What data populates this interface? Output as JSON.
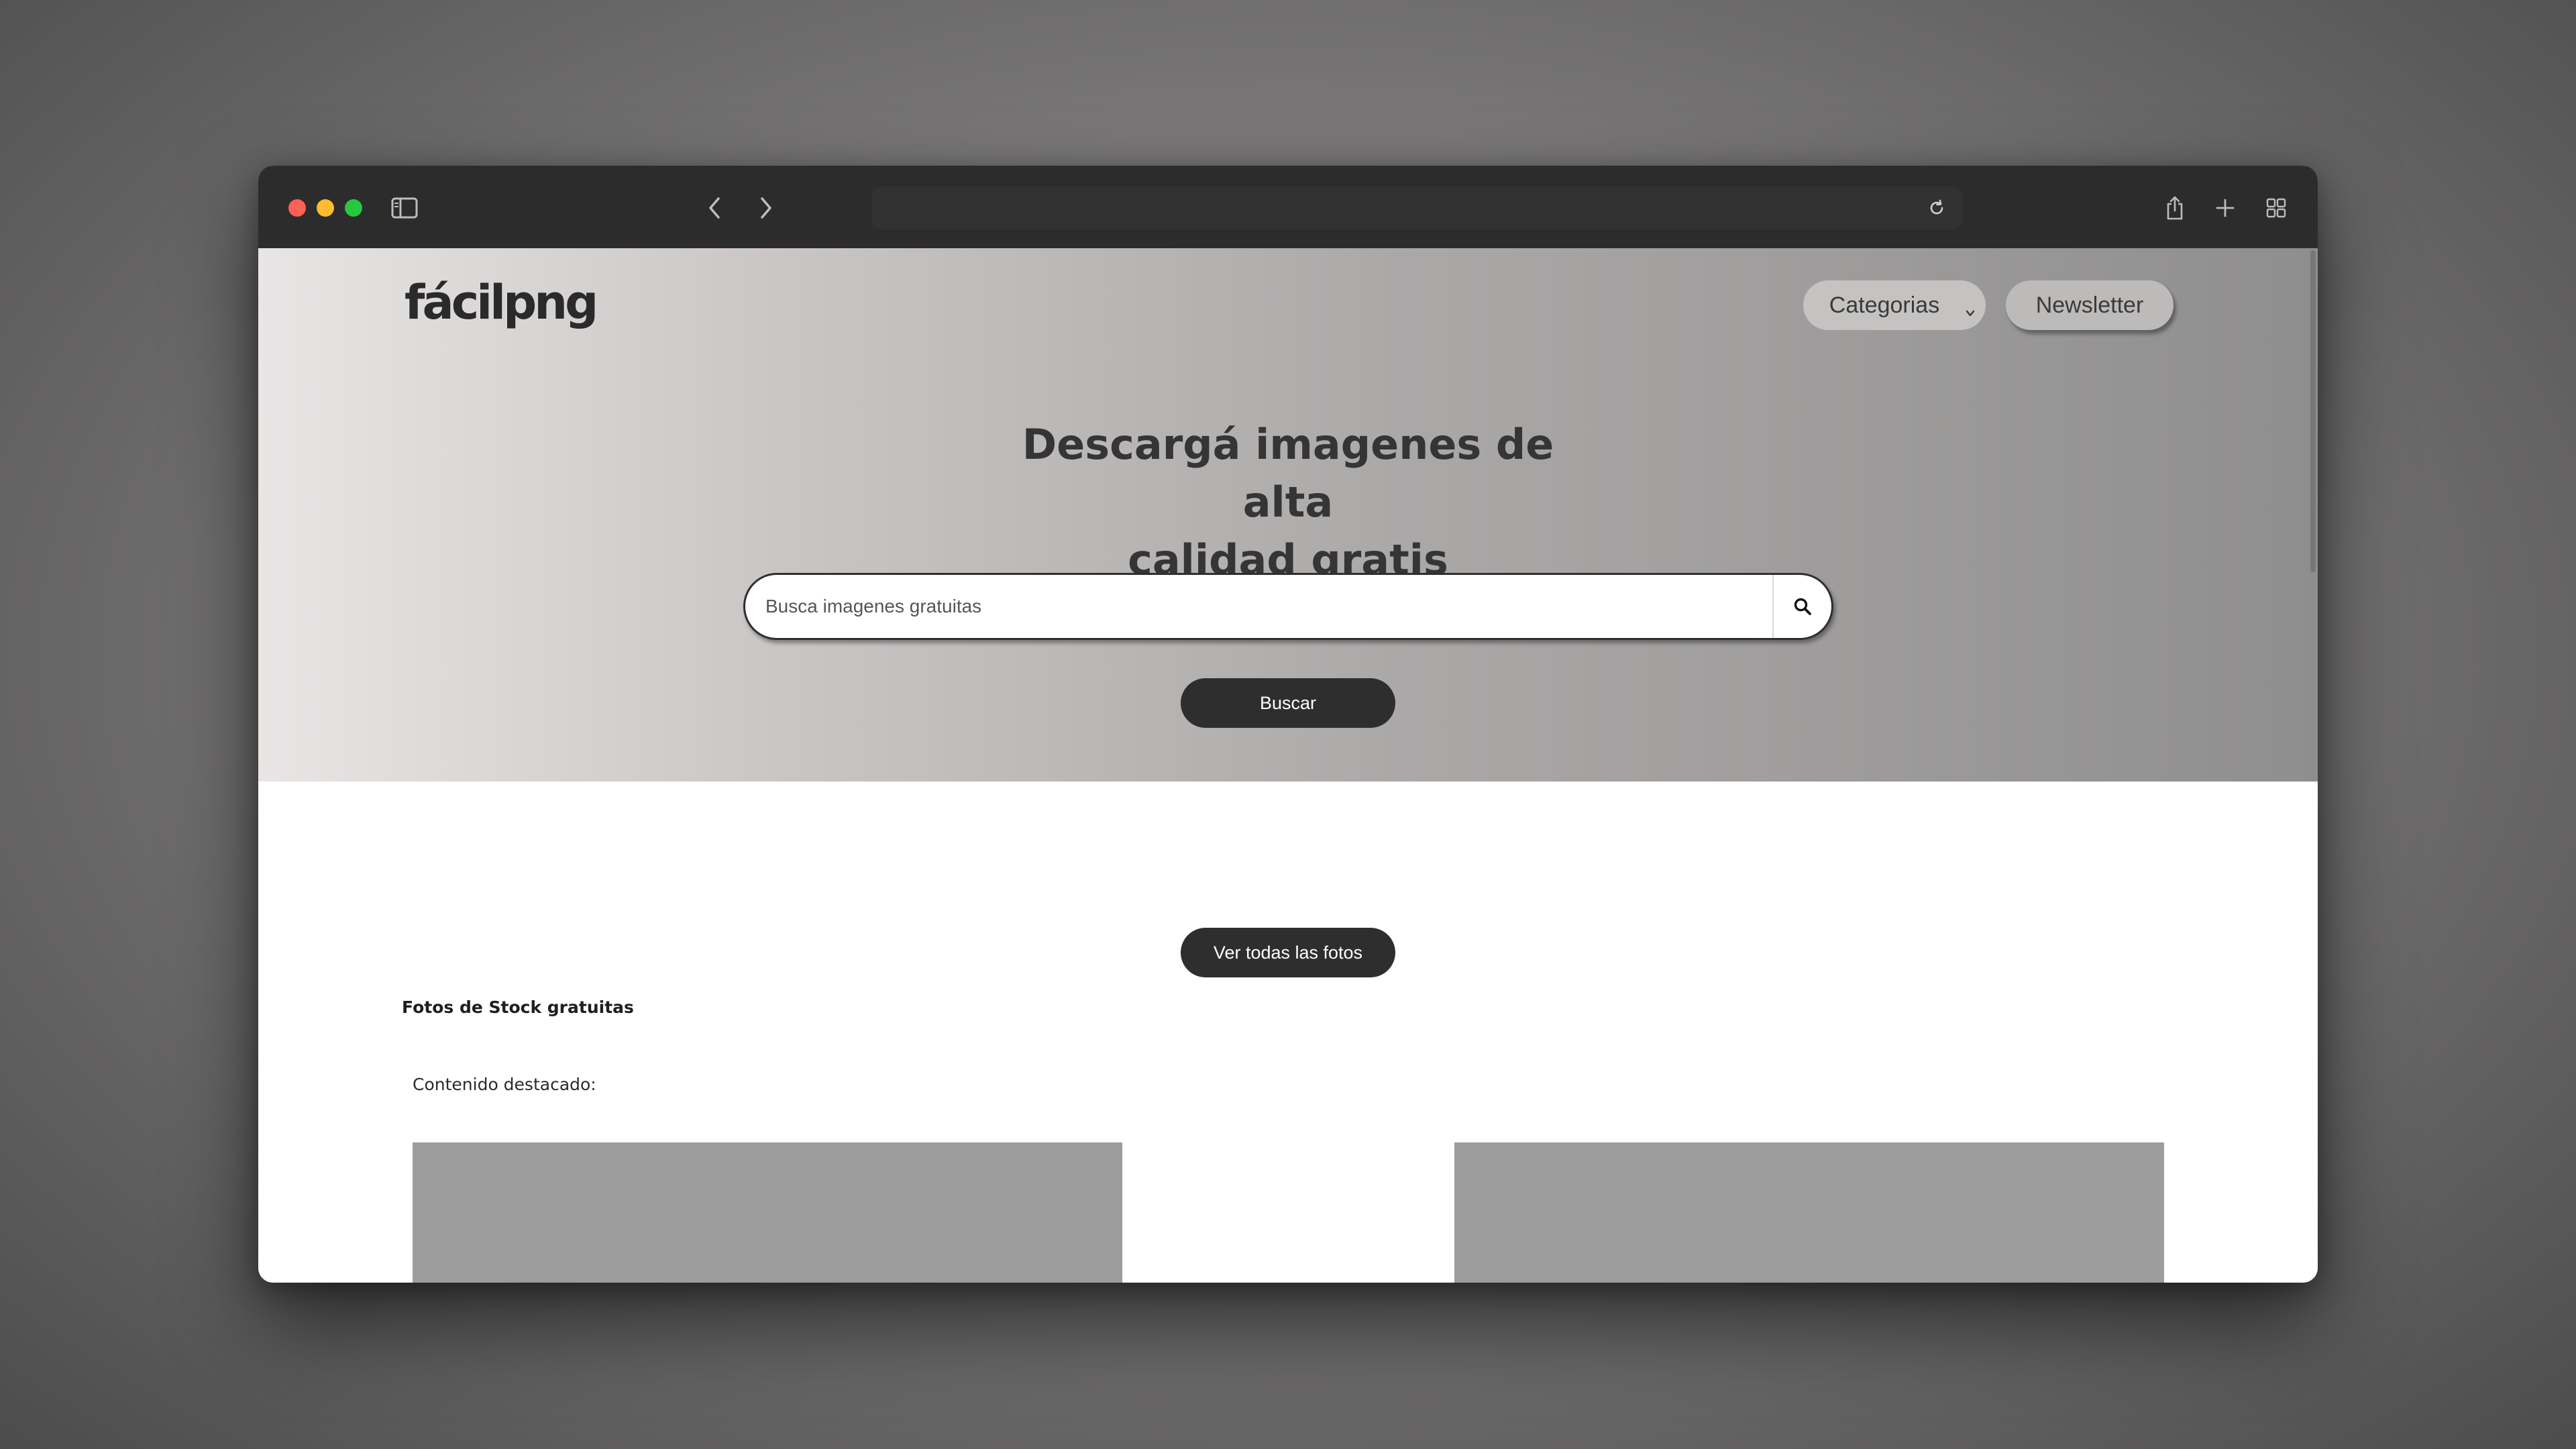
{
  "browser": {
    "url": "",
    "icons": [
      "sidebar-icon",
      "back-icon",
      "forward-icon",
      "reload-icon",
      "share-icon",
      "new-tab-icon",
      "tab-overview-icon"
    ]
  },
  "header": {
    "logo": "fácilpng",
    "categorias_label": "Categorias",
    "newsletter_label": "Newsletter"
  },
  "hero": {
    "title_line1": "Descargá imagenes de alta",
    "title_line2": "calidad gratis",
    "search_placeholder": "Busca imagenes gratuitas",
    "search_button": "Buscar"
  },
  "main": {
    "view_all_button": "Ver todas las fotos",
    "section_title": "Fotos de Stock gratuitas",
    "featured_label": "Contenido destacado:"
  },
  "colors": {
    "dark_button": "#2e2e2e",
    "card_placeholder": "#9d9c9c",
    "toolbar": "#2c2c2c"
  }
}
